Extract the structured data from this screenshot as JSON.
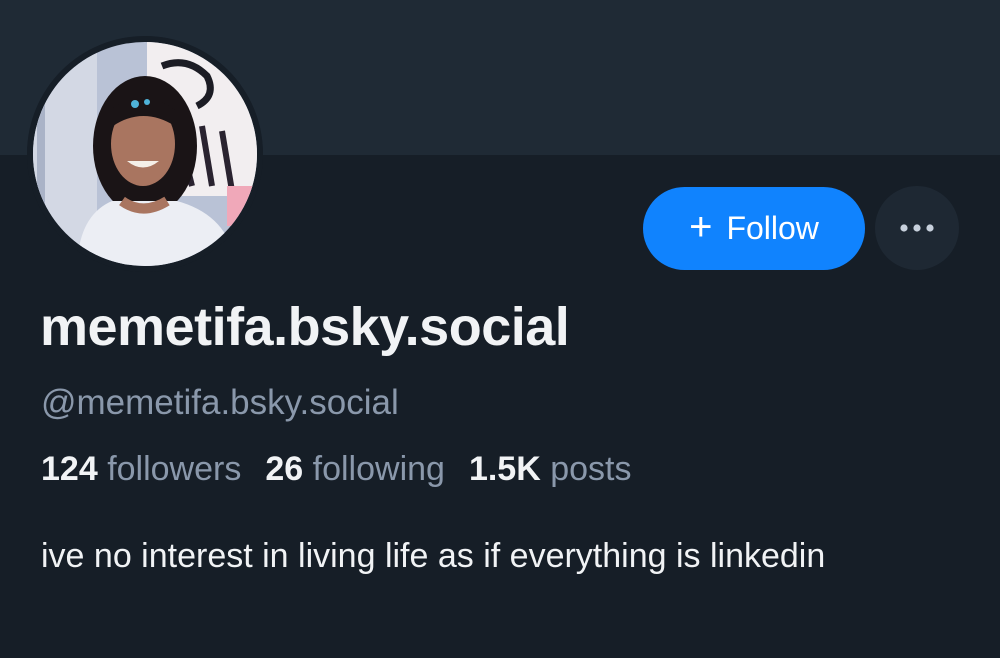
{
  "profile": {
    "display_name": "memetifa.bsky.social",
    "handle": "@memetifa.bsky.social",
    "bio": "ive no interest in living life as if everything is linkedin"
  },
  "actions": {
    "follow_label": "Follow",
    "follow_icon": "plus-icon",
    "more_icon": "ellipsis-icon"
  },
  "stats": {
    "followers": {
      "count": "124",
      "label": "followers"
    },
    "following": {
      "count": "26",
      "label": "following"
    },
    "posts": {
      "count": "1.5K",
      "label": "posts"
    }
  },
  "colors": {
    "background": "#161e27",
    "banner": "#1f2a35",
    "accent": "#1083fe",
    "muted_text": "#8a98ab"
  }
}
